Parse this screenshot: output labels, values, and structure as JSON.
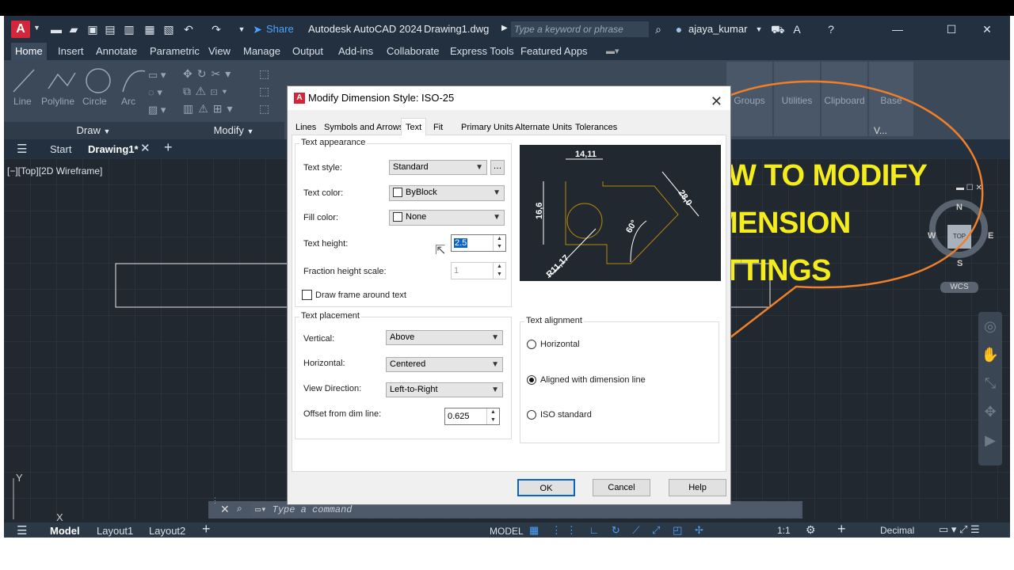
{
  "titlebar": {
    "share": "Share",
    "app_title": "Autodesk AutoCAD 2024",
    "doc": "Drawing1.dwg",
    "search_placeholder": "Type a keyword or phrase",
    "user": "ajaya_kumar"
  },
  "menu_tabs": [
    "Home",
    "Insert",
    "Annotate",
    "Parametric",
    "View",
    "Manage",
    "Output",
    "Add-ins",
    "Collaborate",
    "Express Tools",
    "Featured Apps"
  ],
  "ribbon": {
    "tools": [
      "Line",
      "Polyline",
      "Circle",
      "Arc"
    ],
    "draw_panel": "Draw",
    "modify_panel": "Modify",
    "right_tools": [
      "Groups",
      "Utilities",
      "Clipboard",
      "Base"
    ],
    "view_short": "V..."
  },
  "file_tabs": {
    "start": "Start",
    "drawing": "Drawing1*"
  },
  "viewport_label": "[−][Top][2D Wireframe]",
  "viewcube": {
    "n": "N",
    "s": "S",
    "e": "E",
    "w": "W",
    "top": "TOP",
    "wcs": "WCS"
  },
  "ucs": {
    "y": "Y",
    "x": "X"
  },
  "command_placeholder": "Type a command",
  "status": {
    "model": "Model",
    "layout1": "Layout1",
    "layout2": "Layout2",
    "model_btn": "MODEL",
    "scale": "1:1",
    "units": "Decimal"
  },
  "dialog": {
    "title": "Modify Dimension Style: ISO-25",
    "tabs": [
      "Lines",
      "Symbols and Arrows",
      "Text",
      "Fit",
      "Primary Units",
      "Alternate Units",
      "Tolerances"
    ],
    "text_appearance": {
      "title": "Text appearance",
      "style_label": "Text style:",
      "style": "Standard",
      "color_label": "Text color:",
      "color": "ByBlock",
      "fill_label": "Fill color:",
      "fill": "None",
      "height_label": "Text height:",
      "height": "2.5",
      "fraction_label": "Fraction height scale:",
      "fraction": "1",
      "frame_label": "Draw frame around text"
    },
    "text_placement": {
      "title": "Text placement",
      "vertical_label": "Vertical:",
      "vertical": "Above",
      "horizontal_label": "Horizontal:",
      "horizontal": "Centered",
      "view_label": "View Direction:",
      "view": "Left-to-Right",
      "offset_label": "Offset from dim line:",
      "offset": "0.625"
    },
    "text_alignment": {
      "title": "Text alignment",
      "opt1": "Horizontal",
      "opt2": "Aligned with dimension line",
      "opt3": "ISO standard"
    },
    "preview": {
      "d1": "14,11",
      "d2": "16,6",
      "d3": "28,0",
      "d4": "60°",
      "d5": "R11,17"
    },
    "buttons": {
      "ok": "OK",
      "cancel": "Cancel",
      "help": "Help"
    }
  },
  "callout": {
    "line1": "HOW TO MODIFY",
    "line2": "DIMENSION",
    "line3": "SETTINGS",
    "stroke": "#f07f2a",
    "color": "#f4ec1b"
  }
}
